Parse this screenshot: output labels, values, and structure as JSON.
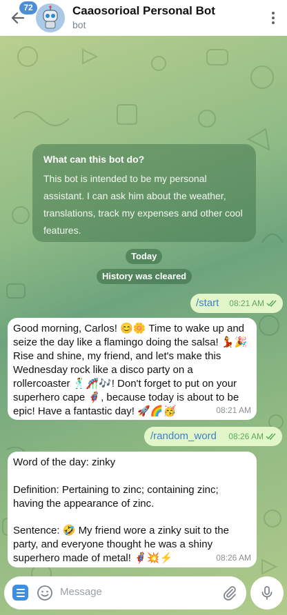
{
  "header": {
    "title": "Caaosorioal Personal Bot",
    "subtitle": "bot",
    "unread_badge": "72"
  },
  "info_card": {
    "title": "What can this bot do?",
    "body": "This bot is intended to be my personal assistant. I can ask him about the weather, translations, track my expenses and other cool features."
  },
  "service": {
    "date_label": "Today",
    "cleared_label": "History was cleared"
  },
  "messages": [
    {
      "direction": "out",
      "text": "/start",
      "time": "08:21 AM",
      "read": true
    },
    {
      "direction": "in",
      "text": "Good morning, Carlos! 😊🌼 Time to wake up and seize the day like a flamingo doing the salsa! 💃🎉 Rise and shine, my friend, and let's make this Wednesday rock like a disco party on a rollercoaster 🕺🎢🎶! Don't forget to put on your superhero cape 🦸, because today is about to be epic! Have a fantastic day! 🚀🌈🥳",
      "time": "08:21 AM"
    },
    {
      "direction": "out",
      "text": "/random_word",
      "time": "08:26 AM",
      "read": true
    },
    {
      "direction": "in",
      "text_lines": [
        "Word of the day: zinky",
        "Definition: Pertaining to zinc; containing zinc; having the appearance of zinc.",
        "Sentence: 🤣 My friend wore a zinky suit to the party, and everyone thought he was a shiny superhero made of metal! 🦸💥⚡"
      ],
      "time": "08:26 AM"
    }
  ],
  "composer": {
    "placeholder": "Message"
  },
  "icons": {
    "back": "arrow-left-icon",
    "menu": "more-vertical-icon",
    "bot_menu": "bot-menu-icon",
    "emoji": "emoji-icon",
    "attach": "paperclip-icon",
    "mic": "microphone-icon"
  },
  "colors": {
    "badge": "#4d8fd6",
    "outgoing_bubble": "#e3f6c9",
    "incoming_bubble": "#ffffff",
    "command_link": "#3a82c6",
    "read_check": "#5aa95c"
  }
}
